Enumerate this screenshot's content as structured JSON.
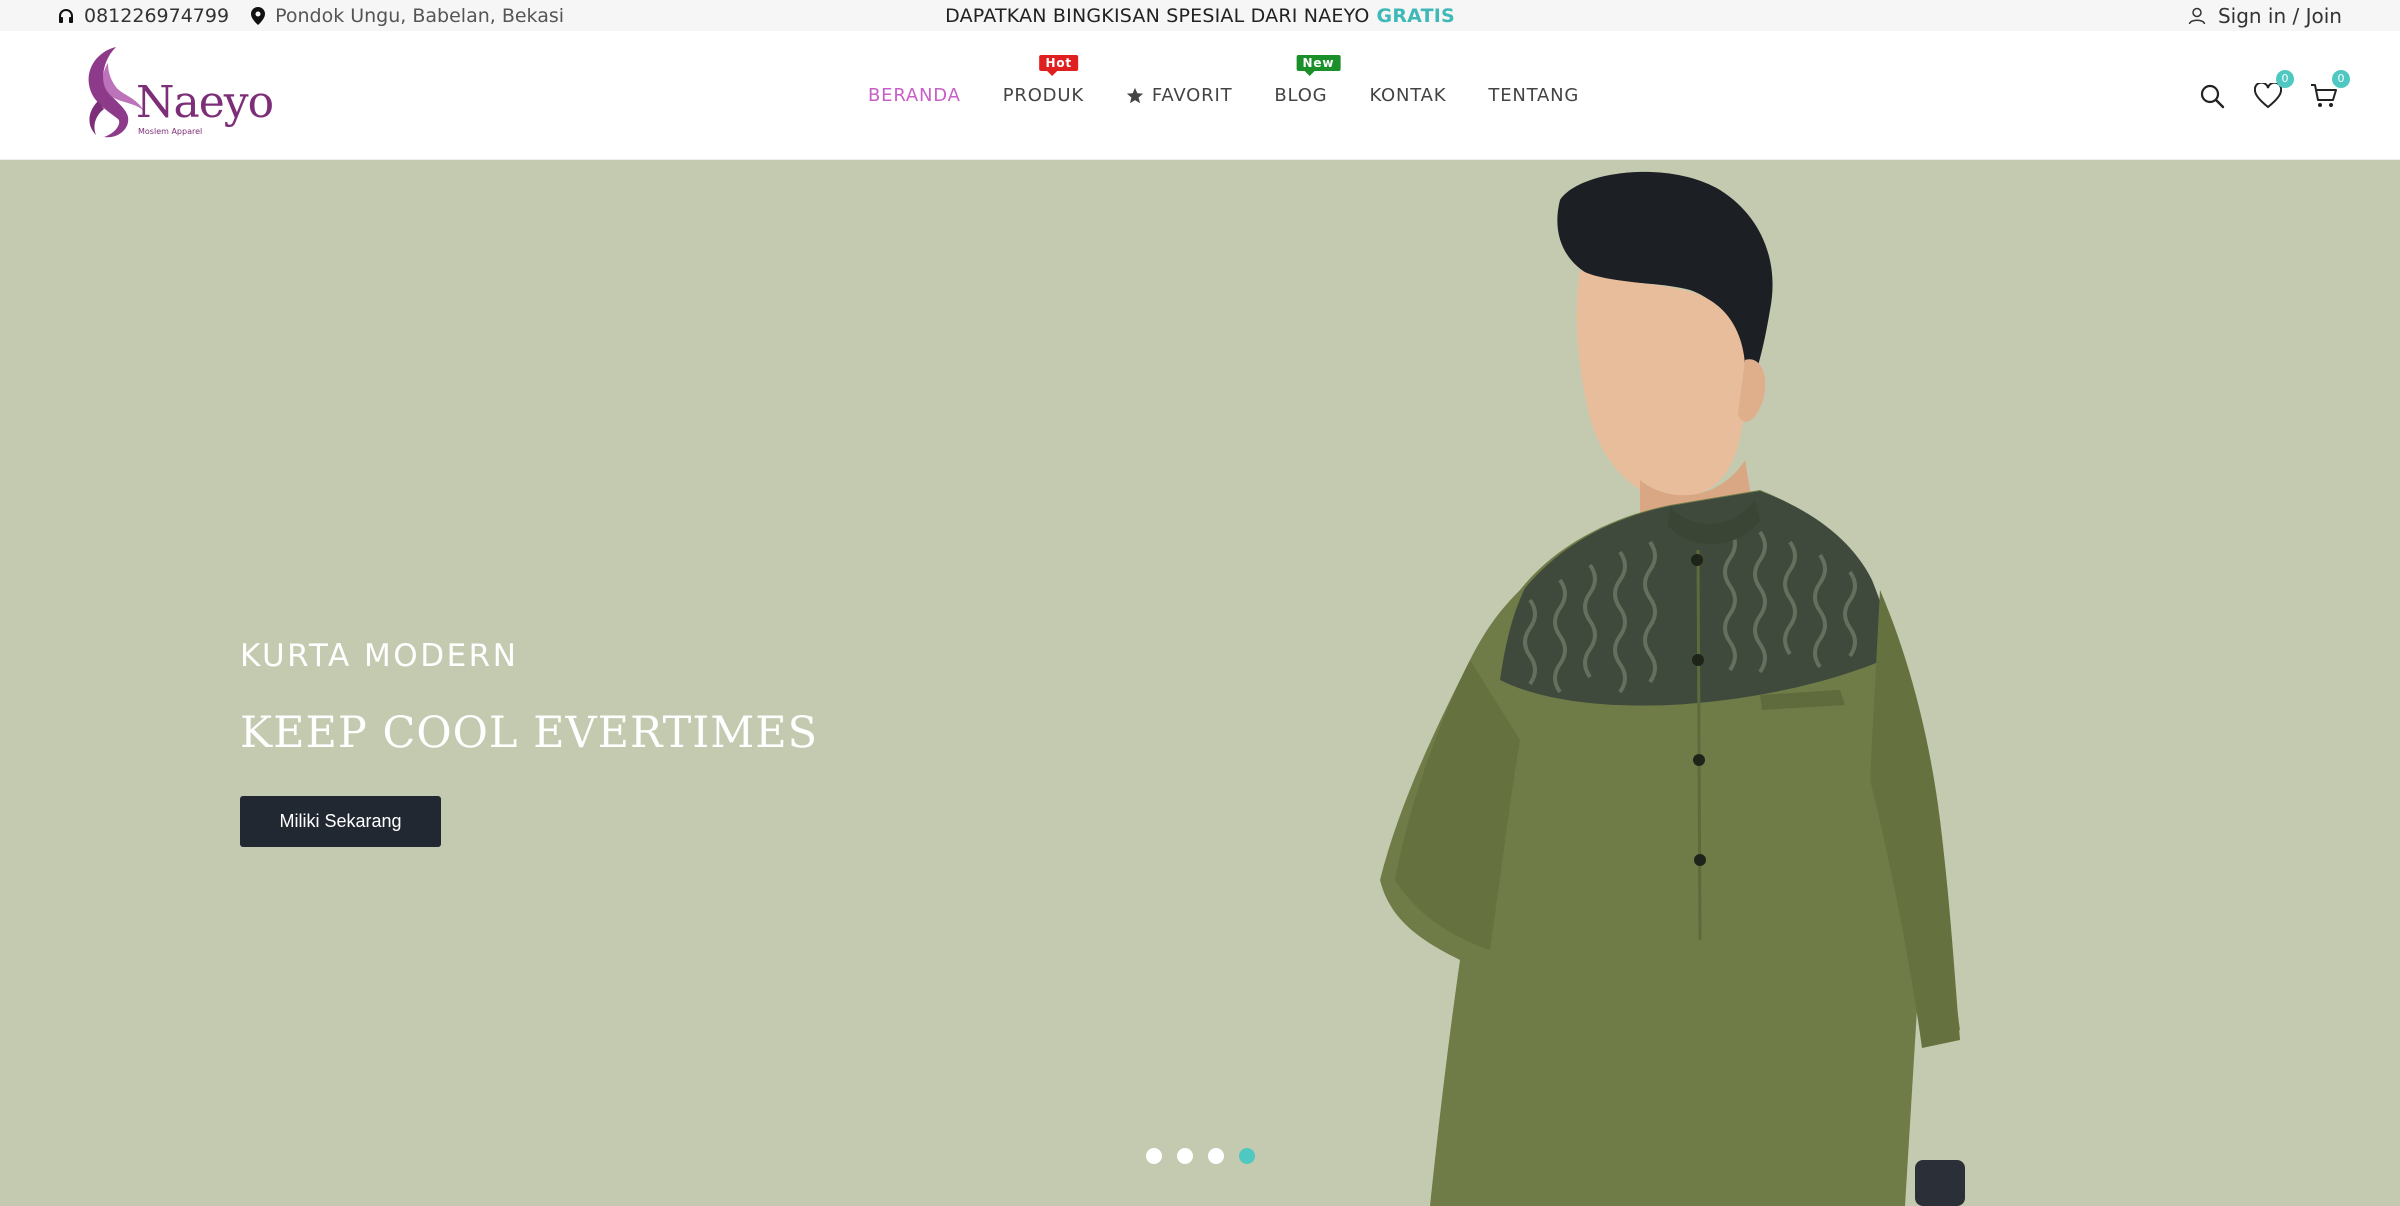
{
  "topbar": {
    "phone": "081226974799",
    "location": "Pondok Ungu, Babelan, Bekasi",
    "promo_text": "DAPATKAN BINGKISAN SPESIAL DARI NAEYO",
    "promo_accent": "GRATIS",
    "account_link": "Sign in / Join"
  },
  "logo": {
    "name": "Naeyo",
    "tagline": "Moslem Apparel"
  },
  "nav": {
    "items": [
      {
        "label": "BERANDA",
        "active": true
      },
      {
        "label": "PRODUK",
        "badge": "Hot"
      },
      {
        "label": "FAVORIT",
        "icon": "star-icon"
      },
      {
        "label": "BLOG",
        "badge": "New"
      },
      {
        "label": "KONTAK"
      },
      {
        "label": "TENTANG"
      }
    ]
  },
  "header_icons": {
    "wishlist_count": "0",
    "cart_count": "0",
    "icons": [
      "search-icon",
      "heart-icon",
      "cart-icon"
    ]
  },
  "hero": {
    "subtitle": "KURTA MODERN",
    "title": "KEEP COOL EVERTIMES",
    "button_label": "Miliki Sekarang",
    "slide_count": 4,
    "active_slide": 4
  },
  "colors": {
    "accent": "#c95ec7",
    "teal": "#4fc8c2",
    "hero_bg": "#c4cab0",
    "button_bg": "#222831",
    "hot_badge": "#e02020",
    "new_badge": "#1a8f2a"
  }
}
